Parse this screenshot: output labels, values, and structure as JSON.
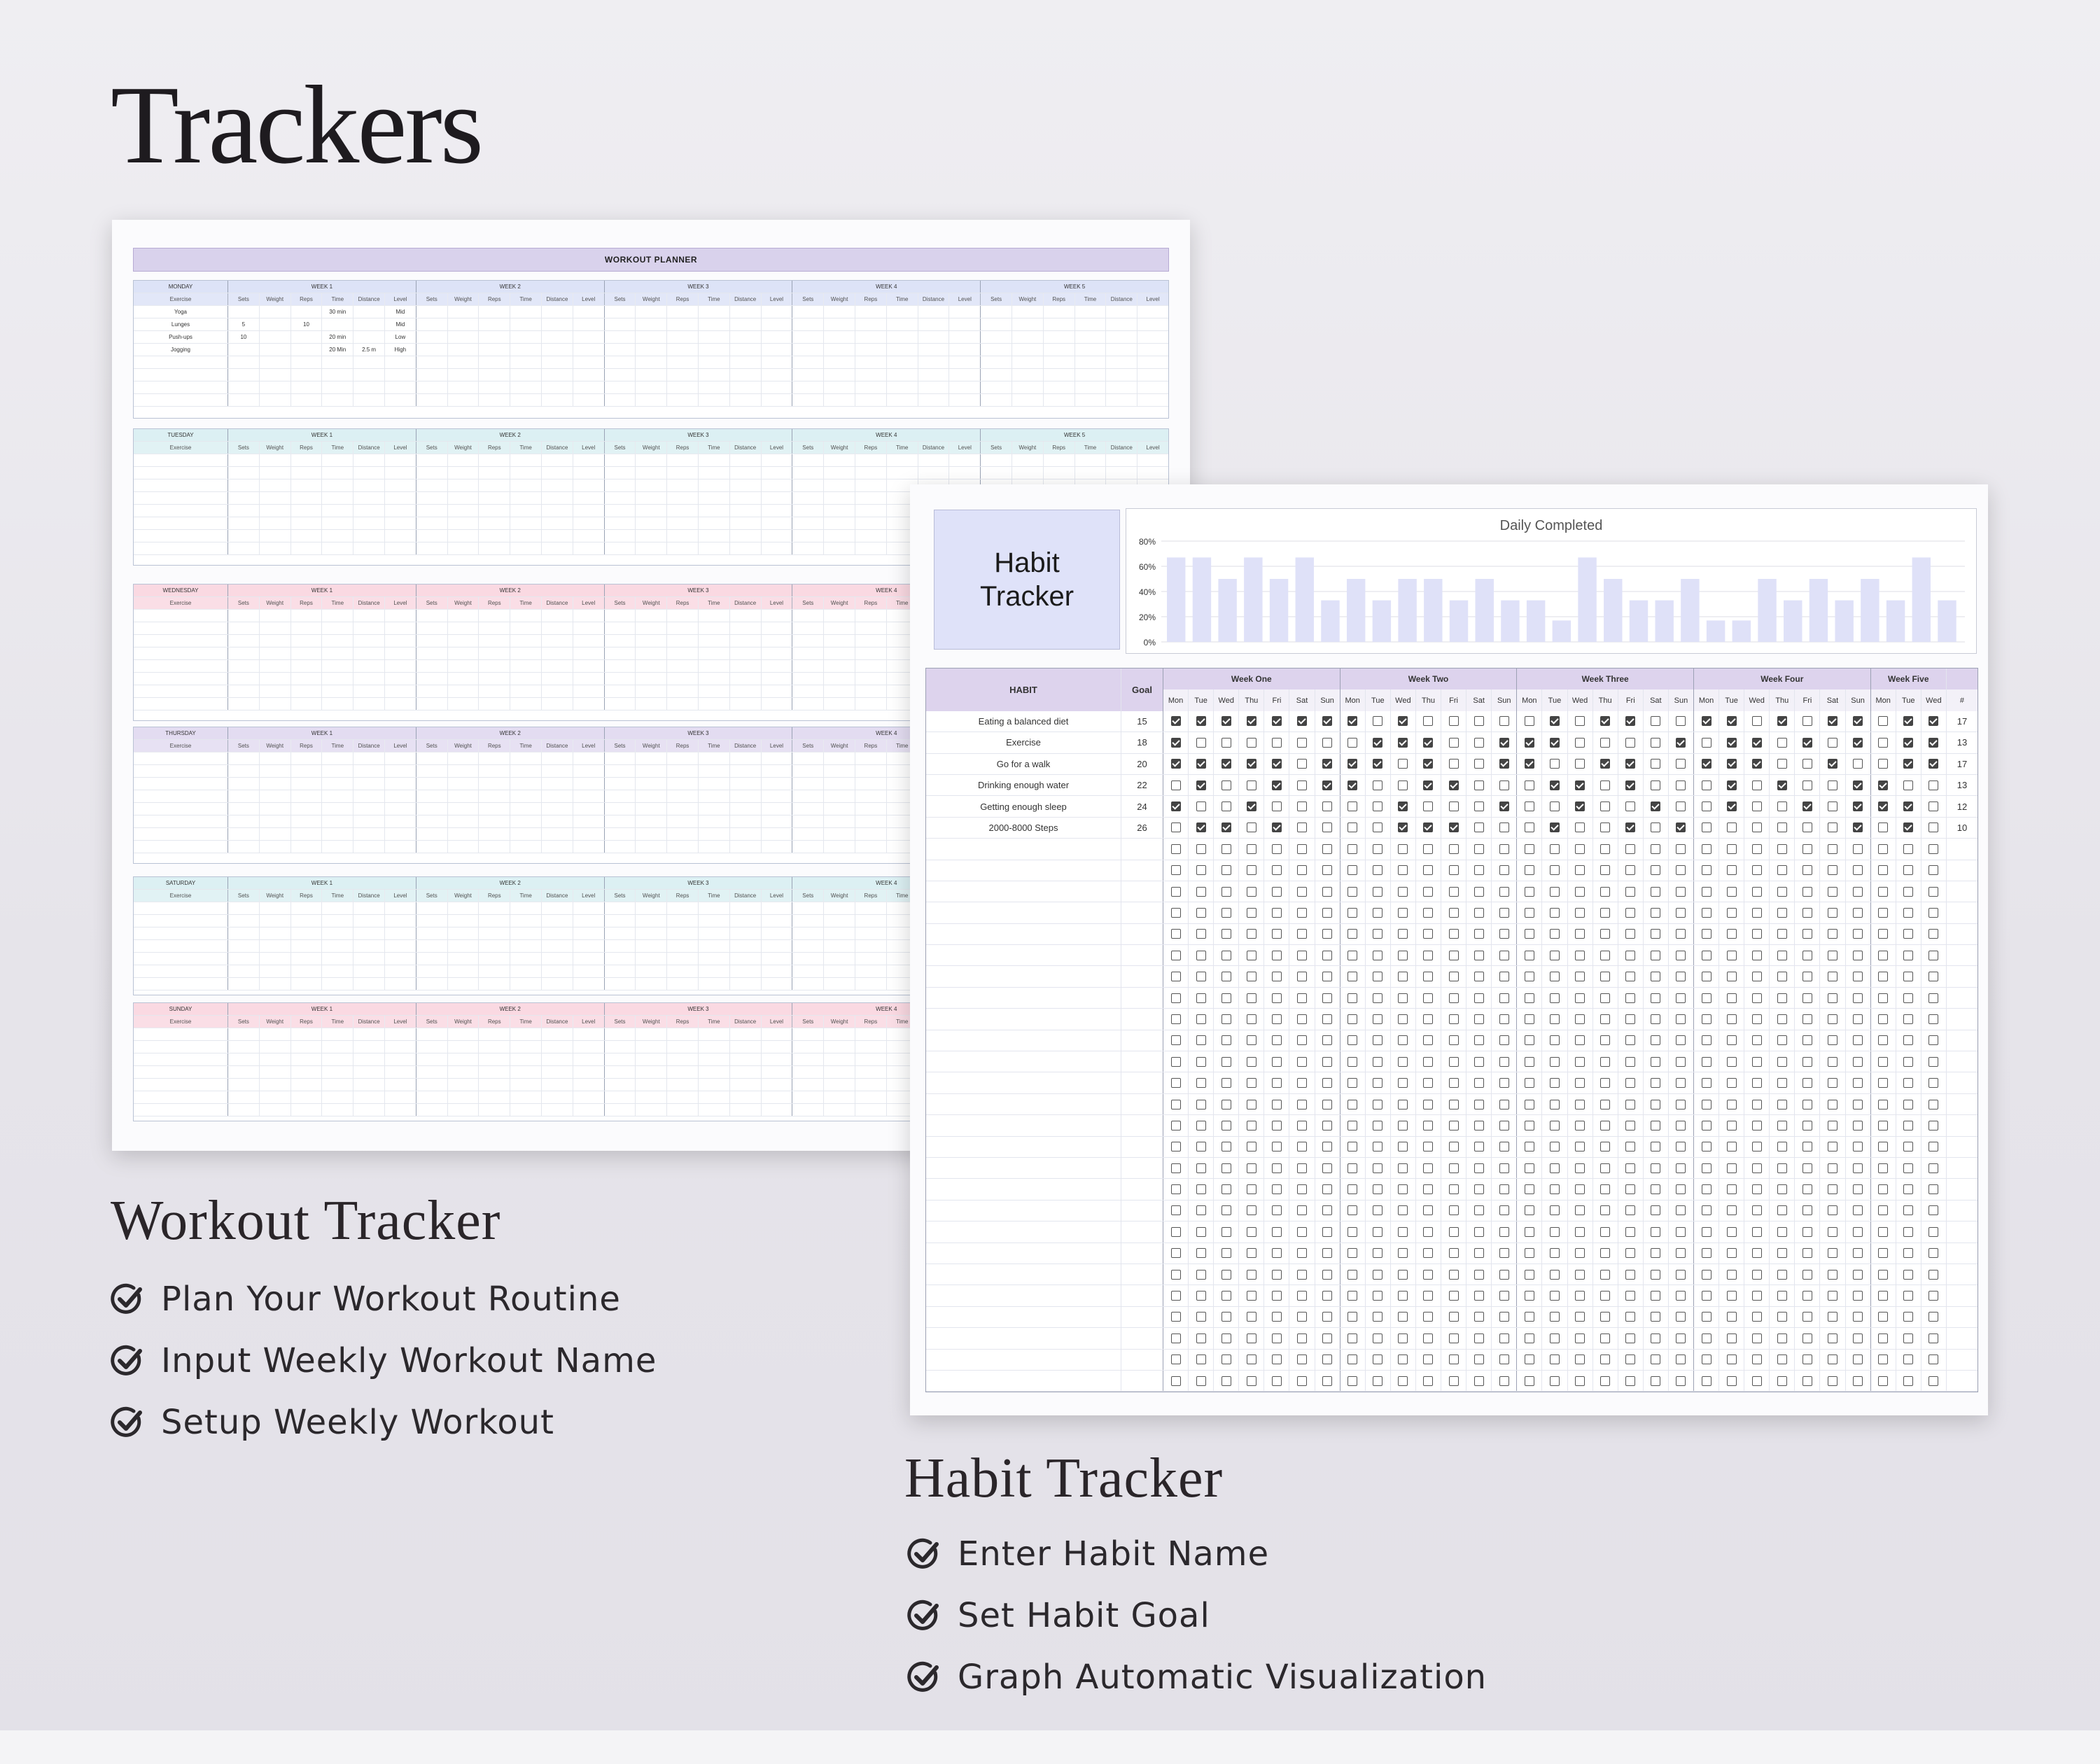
{
  "page_title": "Trackers",
  "workout": {
    "section_title": "Workout Tracker",
    "features": [
      "Plan Your Workout Routine",
      "Input Weekly Workout Name",
      "Setup Weekly Workout"
    ],
    "sheet_title": "WORKOUT PLANNER",
    "days": [
      {
        "name": "MONDAY",
        "color": "#dde3f7",
        "rows": [
          {
            "exercise": "Yoga",
            "time": "30 min",
            "level": "Mid"
          },
          {
            "exercise": "Lunges",
            "sets": "5",
            "reps": "10",
            "level": "Mid"
          },
          {
            "exercise": "Push-ups",
            "sets": "10",
            "time": "20 min",
            "level": "Low"
          },
          {
            "exercise": "Jogging",
            "time": "20 Min",
            "distance": "2.5 m",
            "level": "High"
          }
        ]
      },
      {
        "name": "TUESDAY",
        "color": "#dcf0f3",
        "rows": []
      },
      {
        "name": "WEDNESDAY",
        "color": "#fad9e2",
        "rows": []
      },
      {
        "name": "THURSDAY",
        "color": "#e3dcf1",
        "rows": []
      },
      {
        "name": "SATURDAY",
        "color": "#dcf0f3",
        "rows": []
      },
      {
        "name": "SUNDAY",
        "color": "#fad9e2",
        "rows": []
      }
    ],
    "weeks": [
      "WEEK 1",
      "WEEK 2",
      "WEEK 3",
      "WEEK 4",
      "WEEK 5"
    ],
    "exercise_header": "Exercise",
    "columns": [
      "Sets",
      "Weight",
      "Reps",
      "Time",
      "Distance",
      "Level"
    ]
  },
  "habit": {
    "section_title": "Habit Tracker",
    "features": [
      "Enter Habit Name",
      "Set Habit Goal",
      "Graph Automatic Visualization"
    ],
    "box_title_line1": "Habit",
    "box_title_line2": "Tracker",
    "habit_header": "HABIT",
    "goal_header": "Goal",
    "total_header": "#",
    "weeks": [
      {
        "label": "Week One",
        "days": 7
      },
      {
        "label": "Week Two",
        "days": 7
      },
      {
        "label": "Week Three",
        "days": 7
      },
      {
        "label": "Week Four",
        "days": 7
      },
      {
        "label": "Week Five",
        "days": 3
      }
    ],
    "day_names": [
      "Mon",
      "Tue",
      "Wed",
      "Thu",
      "Fri",
      "Sat",
      "Sun"
    ],
    "habits": [
      {
        "name": "Eating a balanced diet",
        "goal": "15",
        "total": "17",
        "checks": "1111111101000001011001101011011"
      },
      {
        "name": "Exercise",
        "goal": "18",
        "total": "13",
        "checks": "1000000011100111000010110101011"
      },
      {
        "name": "Go for a walk",
        "goal": "20",
        "total": "17",
        "checks": "1111101110100110011001110010011"
      },
      {
        "name": "Drinking enough water",
        "goal": "22",
        "total": "13",
        "checks": "0100101100110001101000101001100"
      },
      {
        "name": "Getting enough sleep",
        "goal": "24",
        "total": "12",
        "checks": "1001000001000100100100100101110"
      },
      {
        "name": "2000-8000 Steps",
        "goal": "26",
        "total": "10",
        "checks": "0110100001110001001010000001010"
      }
    ],
    "empty_rows": 26,
    "bar_color": "#dfe1f8",
    "check_color": "#444444"
  },
  "chart_data": {
    "type": "bar",
    "title": "Daily Completed",
    "y_ticks": [
      "80%",
      "60%",
      "40%",
      "20%",
      "0%"
    ],
    "ylim": [
      0,
      80
    ],
    "values": [
      67,
      67,
      50,
      67,
      50,
      67,
      33,
      50,
      33,
      50,
      50,
      33,
      50,
      33,
      33,
      17,
      67,
      50,
      33,
      33,
      50,
      17,
      17,
      50,
      33,
      50,
      33,
      50,
      33,
      67,
      33
    ]
  }
}
